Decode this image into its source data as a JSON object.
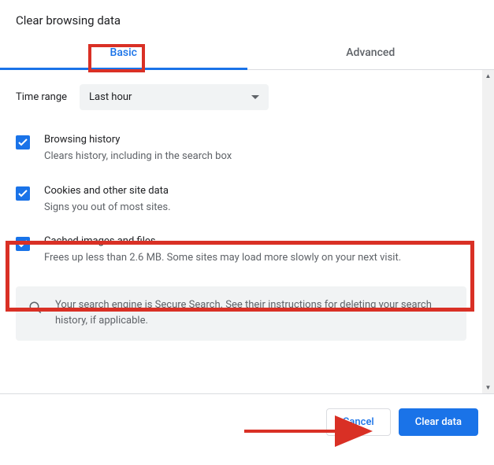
{
  "dialog": {
    "title": "Clear browsing data"
  },
  "tabs": {
    "basic": "Basic",
    "advanced": "Advanced"
  },
  "timeRange": {
    "label": "Time range",
    "value": "Last hour"
  },
  "items": {
    "browsing": {
      "label": "Browsing history",
      "desc": "Clears history, including in the search box"
    },
    "cookies": {
      "label": "Cookies and other site data",
      "desc": "Signs you out of most sites."
    },
    "cached": {
      "label": "Cached images and files",
      "desc": "Frees up less than 2.6 MB. Some sites may load more slowly on your next visit."
    }
  },
  "notice": {
    "text": "Your search engine is Secure Search. See their instructions for deleting your search history, if applicable."
  },
  "footer": {
    "cancel": "Cancel",
    "clear": "Clear data"
  }
}
